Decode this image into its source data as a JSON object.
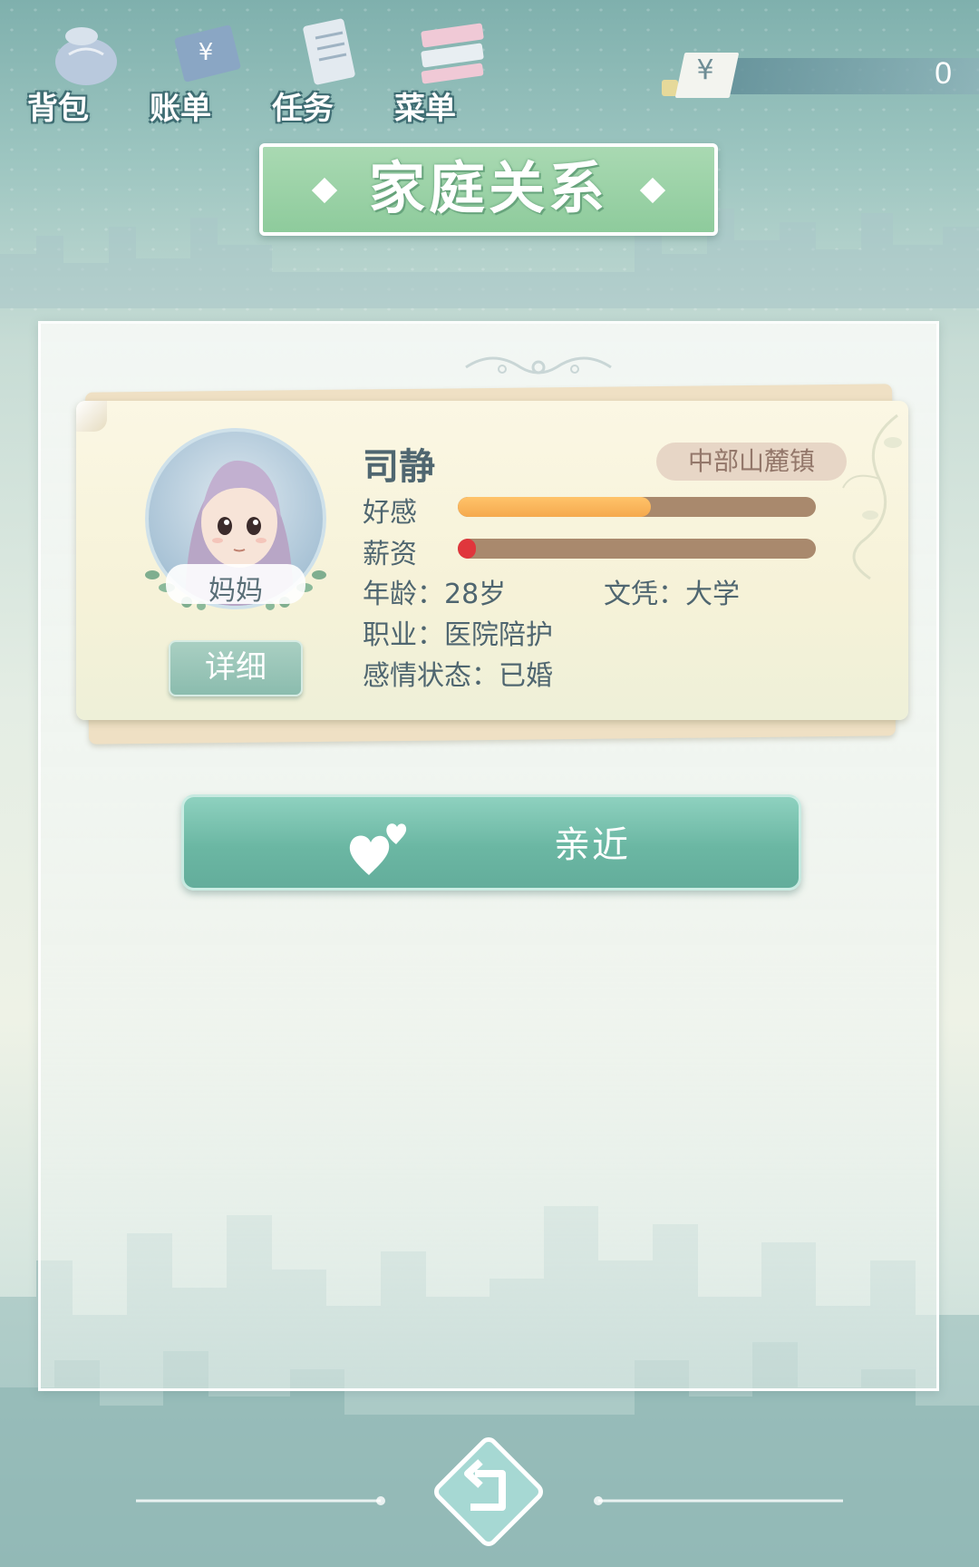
{
  "nav": {
    "items": [
      {
        "label": "背包",
        "icon": "backpack-icon"
      },
      {
        "label": "账单",
        "icon": "bill-icon"
      },
      {
        "label": "任务",
        "icon": "task-icon"
      },
      {
        "label": "菜单",
        "icon": "menu-icon"
      }
    ]
  },
  "money": {
    "symbol": "¥",
    "amount": "0"
  },
  "title": "家庭关系",
  "character": {
    "name": "司静",
    "location": "中部山麓镇",
    "relation": "妈妈",
    "detail_label": "详细",
    "stats": [
      {
        "label": "好感",
        "level": 0.54
      },
      {
        "label": "薪资",
        "level": 0.05
      }
    ],
    "age": "年龄：28岁",
    "education": "文凭：大学",
    "job": "职业：医院陪护",
    "marital": "感情状态：已婚"
  },
  "actions": {
    "approach_label": "亲近"
  },
  "colors": {
    "accent": "#6bb7a3",
    "favor": "#f5a94e",
    "salary": "#e0363c",
    "bar_bg": "#a9896d"
  }
}
